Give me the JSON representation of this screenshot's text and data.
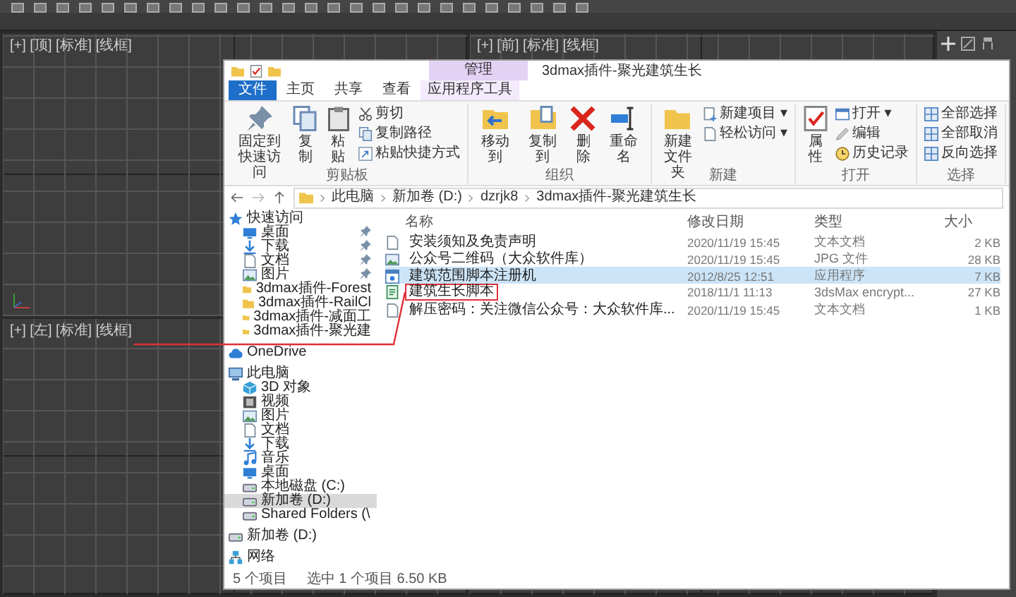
{
  "viewports": [
    {
      "label": "[+] [顶] [标准] [线框]"
    },
    {
      "label": "[+] [前] [标准] [线框]"
    },
    {
      "label": "[+] [左] [标准] [线框]"
    }
  ],
  "explorer": {
    "context_tab": "管理",
    "title": "3dmax插件-聚光建筑生长",
    "ribbon_tabs": [
      {
        "label": "文件",
        "kind": "file"
      },
      {
        "label": "主页",
        "kind": "normal"
      },
      {
        "label": "共享",
        "kind": "normal"
      },
      {
        "label": "查看",
        "kind": "normal"
      },
      {
        "label": "应用程序工具",
        "kind": "context"
      }
    ],
    "ribbon_groups": [
      {
        "label": "剪贴板",
        "large": [
          {
            "lines": [
              "固定到",
              "快速访问"
            ],
            "kind": "pin"
          },
          {
            "lines": [
              "复制"
            ],
            "kind": "pages"
          },
          {
            "lines": [
              "粘贴"
            ],
            "kind": "clipboard"
          }
        ],
        "small": [
          {
            "label": "剪切",
            "kind": "scissors"
          },
          {
            "label": "复制路径",
            "kind": "pages"
          },
          {
            "label": "粘贴快捷方式",
            "kind": "shortcut"
          }
        ]
      },
      {
        "label": "组织",
        "large": [
          {
            "lines": [
              "移动到"
            ],
            "kind": "move"
          },
          {
            "lines": [
              "复制到"
            ],
            "kind": "copyto"
          },
          {
            "lines": [
              "删除"
            ],
            "kind": "delete"
          },
          {
            "lines": [
              "重命名"
            ],
            "kind": "rename"
          }
        ]
      },
      {
        "label": "新建",
        "large": [
          {
            "lines": [
              "新建",
              "文件夹"
            ],
            "kind": "folder"
          }
        ],
        "small": [
          {
            "label": "新建项目 ▾",
            "kind": "newitem"
          },
          {
            "label": "轻松访问 ▾",
            "kind": "page"
          }
        ]
      },
      {
        "label": "打开",
        "large": [
          {
            "lines": [
              "属性"
            ],
            "kind": "properties"
          }
        ],
        "small": [
          {
            "label": "打开 ▾",
            "kind": "window"
          },
          {
            "label": "编辑",
            "kind": "edit"
          },
          {
            "label": "历史记录",
            "kind": "history"
          }
        ]
      },
      {
        "label": "选择",
        "small": [
          {
            "label": "全部选择",
            "kind": "grid"
          },
          {
            "label": "全部取消",
            "kind": "grid"
          },
          {
            "label": "反向选择",
            "kind": "grid"
          }
        ]
      }
    ],
    "address": [
      "此电脑",
      "新加卷 (D:)",
      "dzrjk8",
      "3dmax插件-聚光建筑生长"
    ],
    "nav": [
      {
        "label": "快速访问",
        "kind": "star",
        "selected": false,
        "children": [
          {
            "label": "桌面",
            "kind": "desktop",
            "pinned": true,
            "selected": false
          },
          {
            "label": "下载",
            "kind": "download",
            "pinned": true,
            "selected": false
          },
          {
            "label": "文档",
            "kind": "page",
            "pinned": true,
            "selected": false
          },
          {
            "label": "图片",
            "kind": "picture",
            "pinned": true,
            "selected": false
          },
          {
            "label": "3dmax插件-Forest",
            "kind": "folder",
            "pinned": false,
            "selected": false
          },
          {
            "label": "3dmax插件-RailCl",
            "kind": "folder",
            "pinned": false,
            "selected": false
          },
          {
            "label": "3dmax插件-减面工",
            "kind": "folder",
            "pinned": false,
            "selected": false
          },
          {
            "label": "3dmax插件-聚光建",
            "kind": "folder",
            "pinned": false,
            "selected": false
          }
        ]
      },
      {
        "label": "OneDrive",
        "kind": "cloud",
        "selected": false
      },
      {
        "label": "此电脑",
        "kind": "computer",
        "selected": false,
        "children": [
          {
            "label": "3D 对象",
            "kind": "cube",
            "selected": false
          },
          {
            "label": "视频",
            "kind": "video",
            "selected": false
          },
          {
            "label": "图片",
            "kind": "picture",
            "selected": false
          },
          {
            "label": "文档",
            "kind": "page",
            "selected": false
          },
          {
            "label": "下载",
            "kind": "download",
            "selected": false
          },
          {
            "label": "音乐",
            "kind": "music",
            "selected": false
          },
          {
            "label": "桌面",
            "kind": "desktop",
            "selected": false
          },
          {
            "label": "本地磁盘 (C:)",
            "kind": "drive",
            "selected": false
          },
          {
            "label": "新加卷 (D:)",
            "kind": "drive",
            "selected": true
          },
          {
            "label": "Shared Folders (\\",
            "kind": "drive",
            "selected": false
          }
        ]
      },
      {
        "label": "新加卷 (D:)",
        "kind": "drive",
        "selected": false
      },
      {
        "label": "网络",
        "kind": "network",
        "selected": false
      }
    ],
    "columns": [
      "名称",
      "修改日期",
      "类型",
      "大小"
    ],
    "files": [
      {
        "name": "安装须知及免责声明",
        "date": "2020/11/19 15:45",
        "type": "文本文档",
        "size": "2 KB",
        "kind": "page",
        "selected": false,
        "highlighted": false
      },
      {
        "name": "公众号二维码（大众软件库）",
        "date": "2020/11/19 15:45",
        "type": "JPG 文件",
        "size": "28 KB",
        "kind": "picture",
        "selected": false,
        "highlighted": false
      },
      {
        "name": "建筑范围脚本注册机",
        "date": "2012/8/25 12:51",
        "type": "应用程序",
        "size": "7 KB",
        "kind": "app",
        "selected": true,
        "highlighted": false
      },
      {
        "name": "建筑生长脚本",
        "date": "2018/11/1 11:13",
        "type": "3dsMax encrypt...",
        "size": "27 KB",
        "kind": "script",
        "selected": false,
        "highlighted": true
      },
      {
        "name": "解压密码：关注微信公众号：大众软件库...",
        "date": "2020/11/19 15:45",
        "type": "文本文档",
        "size": "1 KB",
        "kind": "page",
        "selected": false,
        "highlighted": false
      }
    ],
    "status": [
      "5 个项目",
      "选中 1 个项目  6.50 KB"
    ]
  }
}
